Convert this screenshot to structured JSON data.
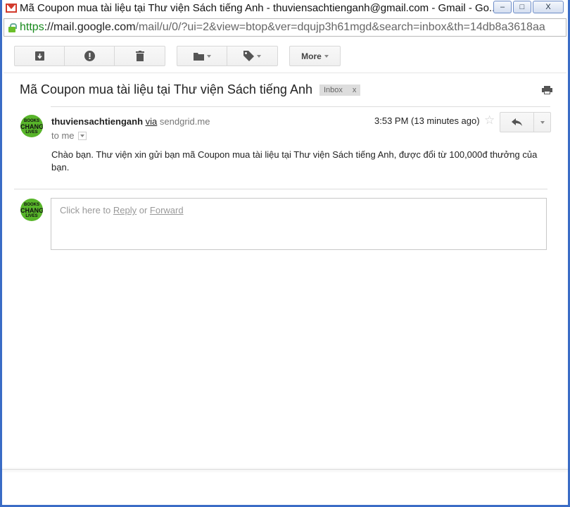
{
  "window": {
    "title": "Mã Coupon mua tài liệu tại Thư viện Sách tiếng Anh - thuviensachtienganh@gmail.com - Gmail - Go...",
    "minimize": "–",
    "maximize": "□",
    "close": "X"
  },
  "address": {
    "scheme": "https",
    "sep": "://",
    "host": "mail.google.com",
    "path": "/mail/u/0/?ui=2&view=btop&ver=dqujp3h61mgd&search=inbox&th=14db8a3618aa"
  },
  "toolbar": {
    "more_label": "More"
  },
  "thread": {
    "subject": "Mã Coupon mua tài liệu tại Thư viện Sách tiếng Anh",
    "label": "Inbox",
    "label_remove": "x"
  },
  "message": {
    "sender": "thuviensachtienganh",
    "via": "via",
    "via_domain": "sendgrid.me",
    "to": "to me",
    "time": "3:53 PM (13 minutes ago)",
    "body": "Chào bạn. Thư viện xin gửi bạn mã Coupon mua tài liệu tại Thư viện Sách tiếng Anh, được đổi từ 100,000đ thưởng của bạn."
  },
  "avatar": {
    "top": "BOOKS",
    "mid": "CHANGE",
    "bot": "LIVES"
  },
  "reply": {
    "prefix": "Click here to ",
    "reply": "Reply",
    "or": " or ",
    "forward": "Forward"
  }
}
